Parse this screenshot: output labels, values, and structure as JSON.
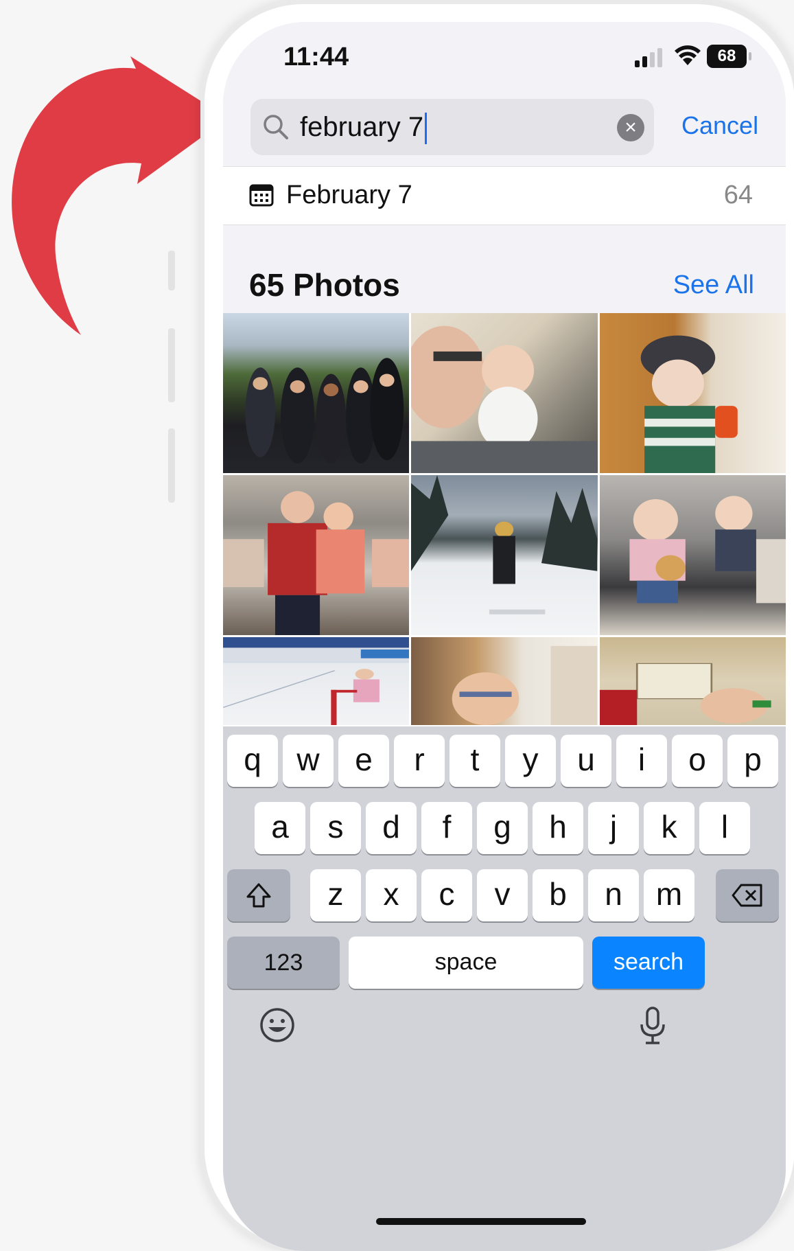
{
  "status_bar": {
    "time": "11:44",
    "battery": "68"
  },
  "search": {
    "query": "february 7",
    "cancel_label": "Cancel"
  },
  "suggestion": {
    "label": "February 7",
    "count": "64"
  },
  "results": {
    "title": "65 Photos",
    "see_all_label": "See All"
  },
  "photos": [
    {
      "name": "photo-group-outdoors"
    },
    {
      "name": "photo-man-with-baby"
    },
    {
      "name": "photo-child-with-helmet"
    },
    {
      "name": "photo-couple-at-market"
    },
    {
      "name": "photo-skier-on-slope"
    },
    {
      "name": "photo-kids-in-car-seats"
    },
    {
      "name": "photo-child-ice-skating"
    },
    {
      "name": "photo-boy-with-glasses"
    },
    {
      "name": "photo-board-game"
    }
  ],
  "keyboard": {
    "row1": [
      "q",
      "w",
      "e",
      "r",
      "t",
      "y",
      "u",
      "i",
      "o",
      "p"
    ],
    "row2": [
      "a",
      "s",
      "d",
      "f",
      "g",
      "h",
      "j",
      "k",
      "l"
    ],
    "row3": [
      "z",
      "x",
      "c",
      "v",
      "b",
      "n",
      "m"
    ],
    "numbers_label": "123",
    "space_label": "space",
    "search_label": "search"
  },
  "colors": {
    "accent": "#1a73e8",
    "arrow": "#e03c45",
    "search_key": "#0b84ff"
  },
  "icons": [
    "search-icon",
    "clear-icon",
    "calendar-icon",
    "shift-icon",
    "backspace-icon",
    "emoji-icon",
    "microphone-icon",
    "cellular-signal-icon",
    "wifi-icon",
    "curved-arrow-icon"
  ]
}
